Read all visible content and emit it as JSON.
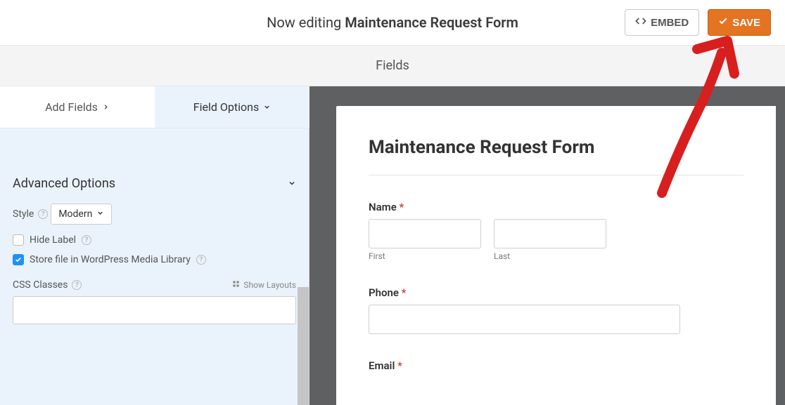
{
  "topbar": {
    "editing_prefix": "Now editing ",
    "form_name": "Maintenance Request Form",
    "embed_label": "EMBED",
    "save_label": "SAVE"
  },
  "fields_header": "Fields",
  "tabs": {
    "add_fields": "Add Fields",
    "field_options": "Field Options"
  },
  "sidebar": {
    "section_title": "Advanced Options",
    "style_label": "Style",
    "style_value": "Modern",
    "hide_label": "Hide Label",
    "store_file_label": "Store file in WordPress Media Library",
    "css_classes_label": "CSS Classes",
    "show_layouts_label": "Show Layouts"
  },
  "preview": {
    "title": "Maintenance Request Form",
    "name_label": "Name",
    "first_label": "First",
    "last_label": "Last",
    "phone_label": "Phone",
    "email_label": "Email"
  }
}
